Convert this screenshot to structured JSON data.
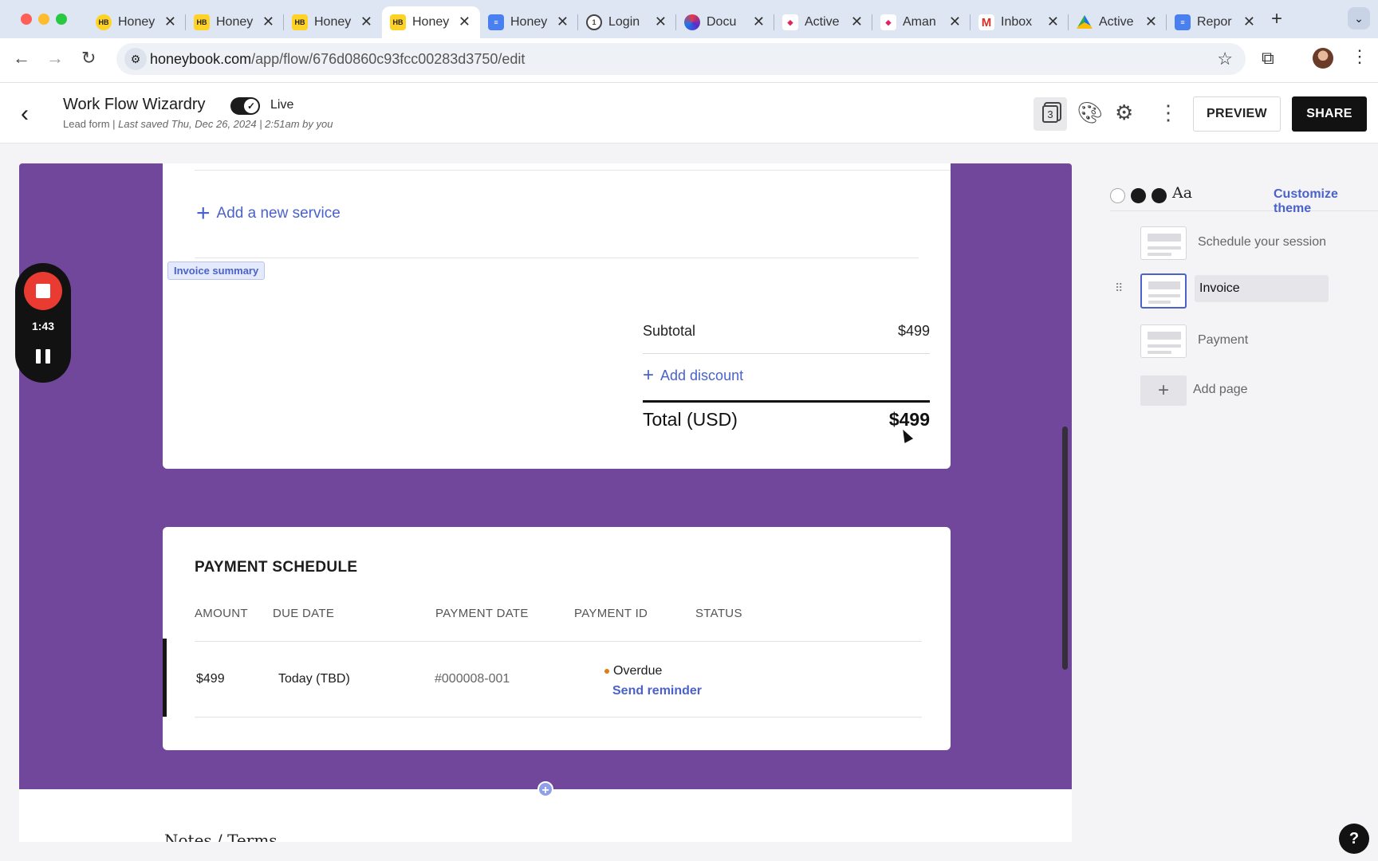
{
  "browser": {
    "tabs": [
      {
        "title": "Honey",
        "favicon": "honeybook-circle-icon",
        "active": false
      },
      {
        "title": "Honey",
        "favicon": "honeybook-icon",
        "active": false
      },
      {
        "title": "Honey",
        "favicon": "honeybook-icon",
        "active": false
      },
      {
        "title": "Honey",
        "favicon": "honeybook-icon",
        "active": true
      },
      {
        "title": "Honey",
        "favicon": "google-docs-icon",
        "active": false
      },
      {
        "title": "Login",
        "favicon": "1password-icon",
        "active": false
      },
      {
        "title": "Docu",
        "favicon": "docusign-icon",
        "active": false
      },
      {
        "title": "Active",
        "favicon": "clickup-icon",
        "active": false
      },
      {
        "title": "Aman",
        "favicon": "clickup-icon",
        "active": false
      },
      {
        "title": "Inbox",
        "favicon": "gmail-icon",
        "active": false
      },
      {
        "title": "Active",
        "favicon": "google-drive-icon",
        "active": false
      },
      {
        "title": "Repor",
        "favicon": "google-docs-icon",
        "active": false
      }
    ],
    "hb_glyph": "HB",
    "gmail_glyph": "M",
    "clickup_glyph": "◆",
    "onepassword_glyph": "1",
    "tab_close": "✕",
    "new_tab": "+",
    "tab_menu": "⌄",
    "url_host": "honeybook.com",
    "url_path": "/app/flow/676d0860c93fcc00283d3750/edit"
  },
  "header": {
    "title": "Work Flow Wizardry",
    "live_label": "Live",
    "live_on": true,
    "subtitle_prefix": "Lead form | ",
    "subtitle_saved": "Last saved Thu, Dec 26, 2024 | 2:51am by you",
    "pages_count": "3",
    "preview_label": "PREVIEW",
    "share_label": "SHARE"
  },
  "invoice": {
    "add_service_label": "Add a new service",
    "section_chip": "Invoice summary",
    "subtotal_label": "Subtotal",
    "subtotal_value": "$499",
    "add_discount_label": "Add discount",
    "total_label": "Total (USD)",
    "total_value": "$499"
  },
  "payment_schedule": {
    "title": "PAYMENT SCHEDULE",
    "columns": [
      "AMOUNT",
      "DUE DATE",
      "PAYMENT DATE",
      "PAYMENT ID",
      "STATUS"
    ],
    "rows": [
      {
        "amount": "$499",
        "due_date": "Today (TBD)",
        "payment_id": "#000008-001",
        "status": "Overdue",
        "action": "Send reminder"
      }
    ]
  },
  "notes_title": "Notes / Terms",
  "recorder": {
    "time": "1:43"
  },
  "theme": {
    "aa_label": "Aa",
    "customize_label": "Customize theme",
    "accent": "#4a62c9",
    "canvas_bg": "#71479b"
  },
  "pages": [
    {
      "label": "Schedule your session",
      "selected": false
    },
    {
      "label": "Invoice",
      "selected": true
    },
    {
      "label": "Payment",
      "selected": false
    }
  ],
  "add_page_label": "Add page",
  "help_label": "?"
}
